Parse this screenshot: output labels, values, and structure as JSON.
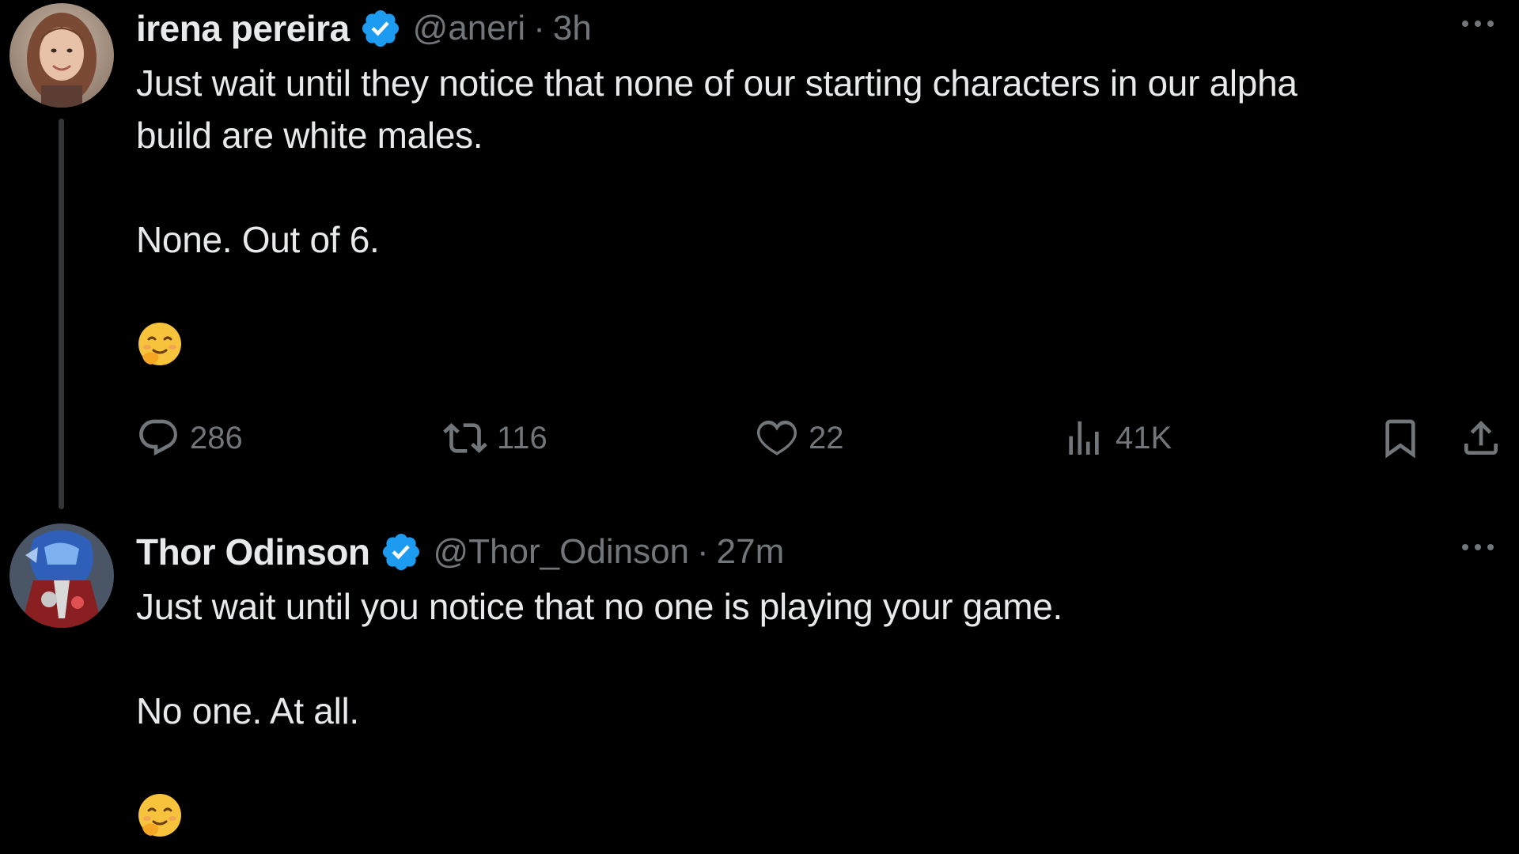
{
  "tweets": [
    {
      "display_name": "irena pereira",
      "handle": "@aneri",
      "separator": "·",
      "time": "3h",
      "text_line_1": "Just wait until they notice that none of our starting characters in our alpha",
      "text_line_2": "build are white males.",
      "text_line_3": "None. Out of 6.",
      "emoji": "😊",
      "stats": {
        "replies": "286",
        "retweets": "116",
        "likes": "22",
        "views": "41K"
      },
      "avatar_icon": "woman-portrait-avatar"
    },
    {
      "display_name": "Thor Odinson",
      "handle": "@Thor_Odinson",
      "separator": "·",
      "time": "27m",
      "text_line_1": "Just wait until you notice that no one is playing your game.",
      "text_line_2": "No one. At all.",
      "emoji": "😊",
      "avatar_icon": "armored-character-avatar"
    }
  ],
  "colors": {
    "background": "#000000",
    "primary_text": "#e7e9ea",
    "secondary_text": "#71767b",
    "verified_badge": "#1d9bf0",
    "thread_line": "#333639"
  },
  "icons": [
    "verified-badge-icon",
    "more-icon",
    "reply-icon",
    "retweet-icon",
    "like-icon",
    "views-icon",
    "bookmark-icon",
    "share-icon"
  ]
}
